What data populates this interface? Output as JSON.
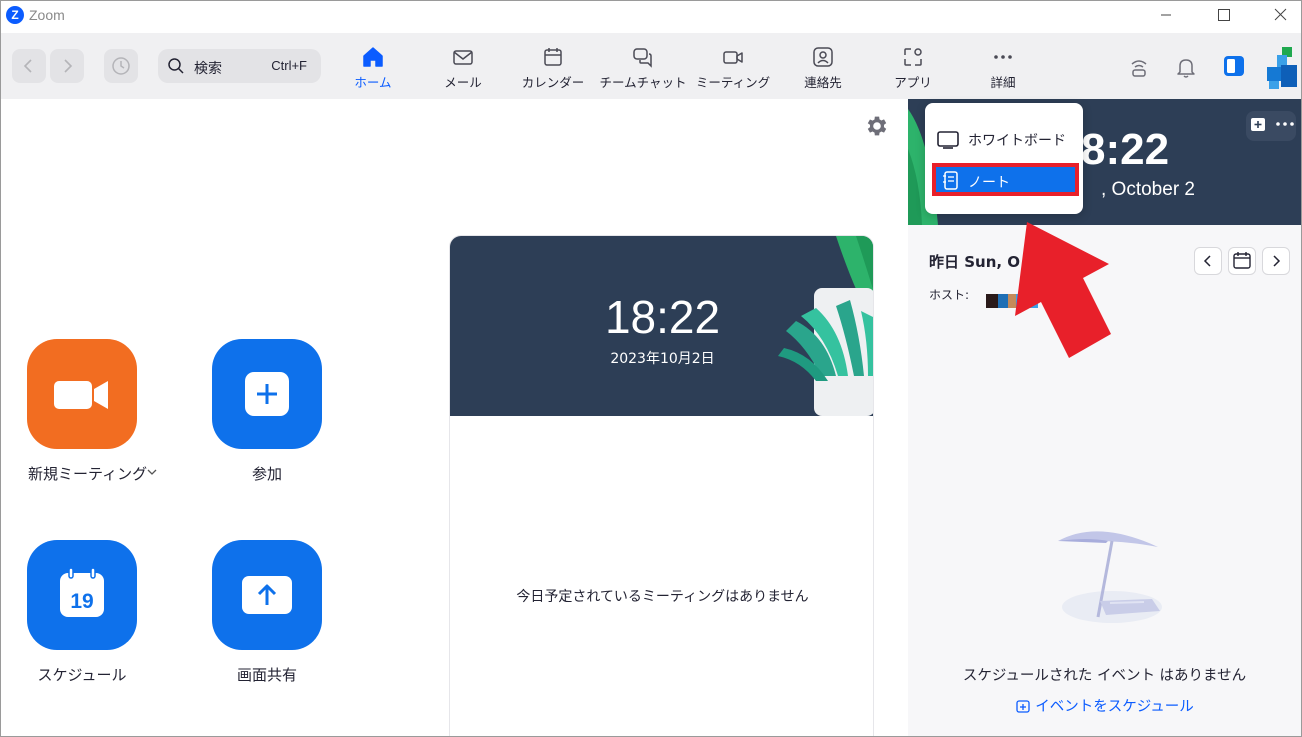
{
  "window": {
    "title": "Zoom",
    "logo_letter": "Z"
  },
  "search": {
    "label": "検索",
    "shortcut": "Ctrl+F"
  },
  "tabs": [
    {
      "label": "ホーム",
      "icon": "home-icon",
      "active": true
    },
    {
      "label": "メール",
      "icon": "mail-icon"
    },
    {
      "label": "カレンダー",
      "icon": "calendar-icon"
    },
    {
      "label": "チームチャット",
      "icon": "chat-icon"
    },
    {
      "label": "ミーティング",
      "icon": "video-icon"
    },
    {
      "label": "連絡先",
      "icon": "contacts-icon"
    },
    {
      "label": "アプリ",
      "icon": "apps-icon"
    },
    {
      "label": "詳細",
      "icon": "more-icon"
    }
  ],
  "actions": {
    "new_meeting": "新規ミーティング",
    "join": "参加",
    "schedule": "スケジュール",
    "schedule_day": "19",
    "share": "画面共有"
  },
  "card": {
    "time": "18:22",
    "date": "2023年10月2日",
    "empty": "今日予定されているミーティングはありません"
  },
  "right_panel": {
    "time": "8:22",
    "date": ", October 2",
    "day_label": "昨日 Sun, O",
    "host_label": "ホスト:",
    "no_events": "スケジュールされた イベント はありません",
    "schedule_link": "イベントをスケジュール"
  },
  "dropdown": {
    "whiteboard": "ホワイトボード",
    "notes": "ノート"
  },
  "colors": {
    "accent": "#0b5cff",
    "orange": "#f26d21",
    "highlight": "#e8202a",
    "header_bg": "#2d3e56"
  }
}
